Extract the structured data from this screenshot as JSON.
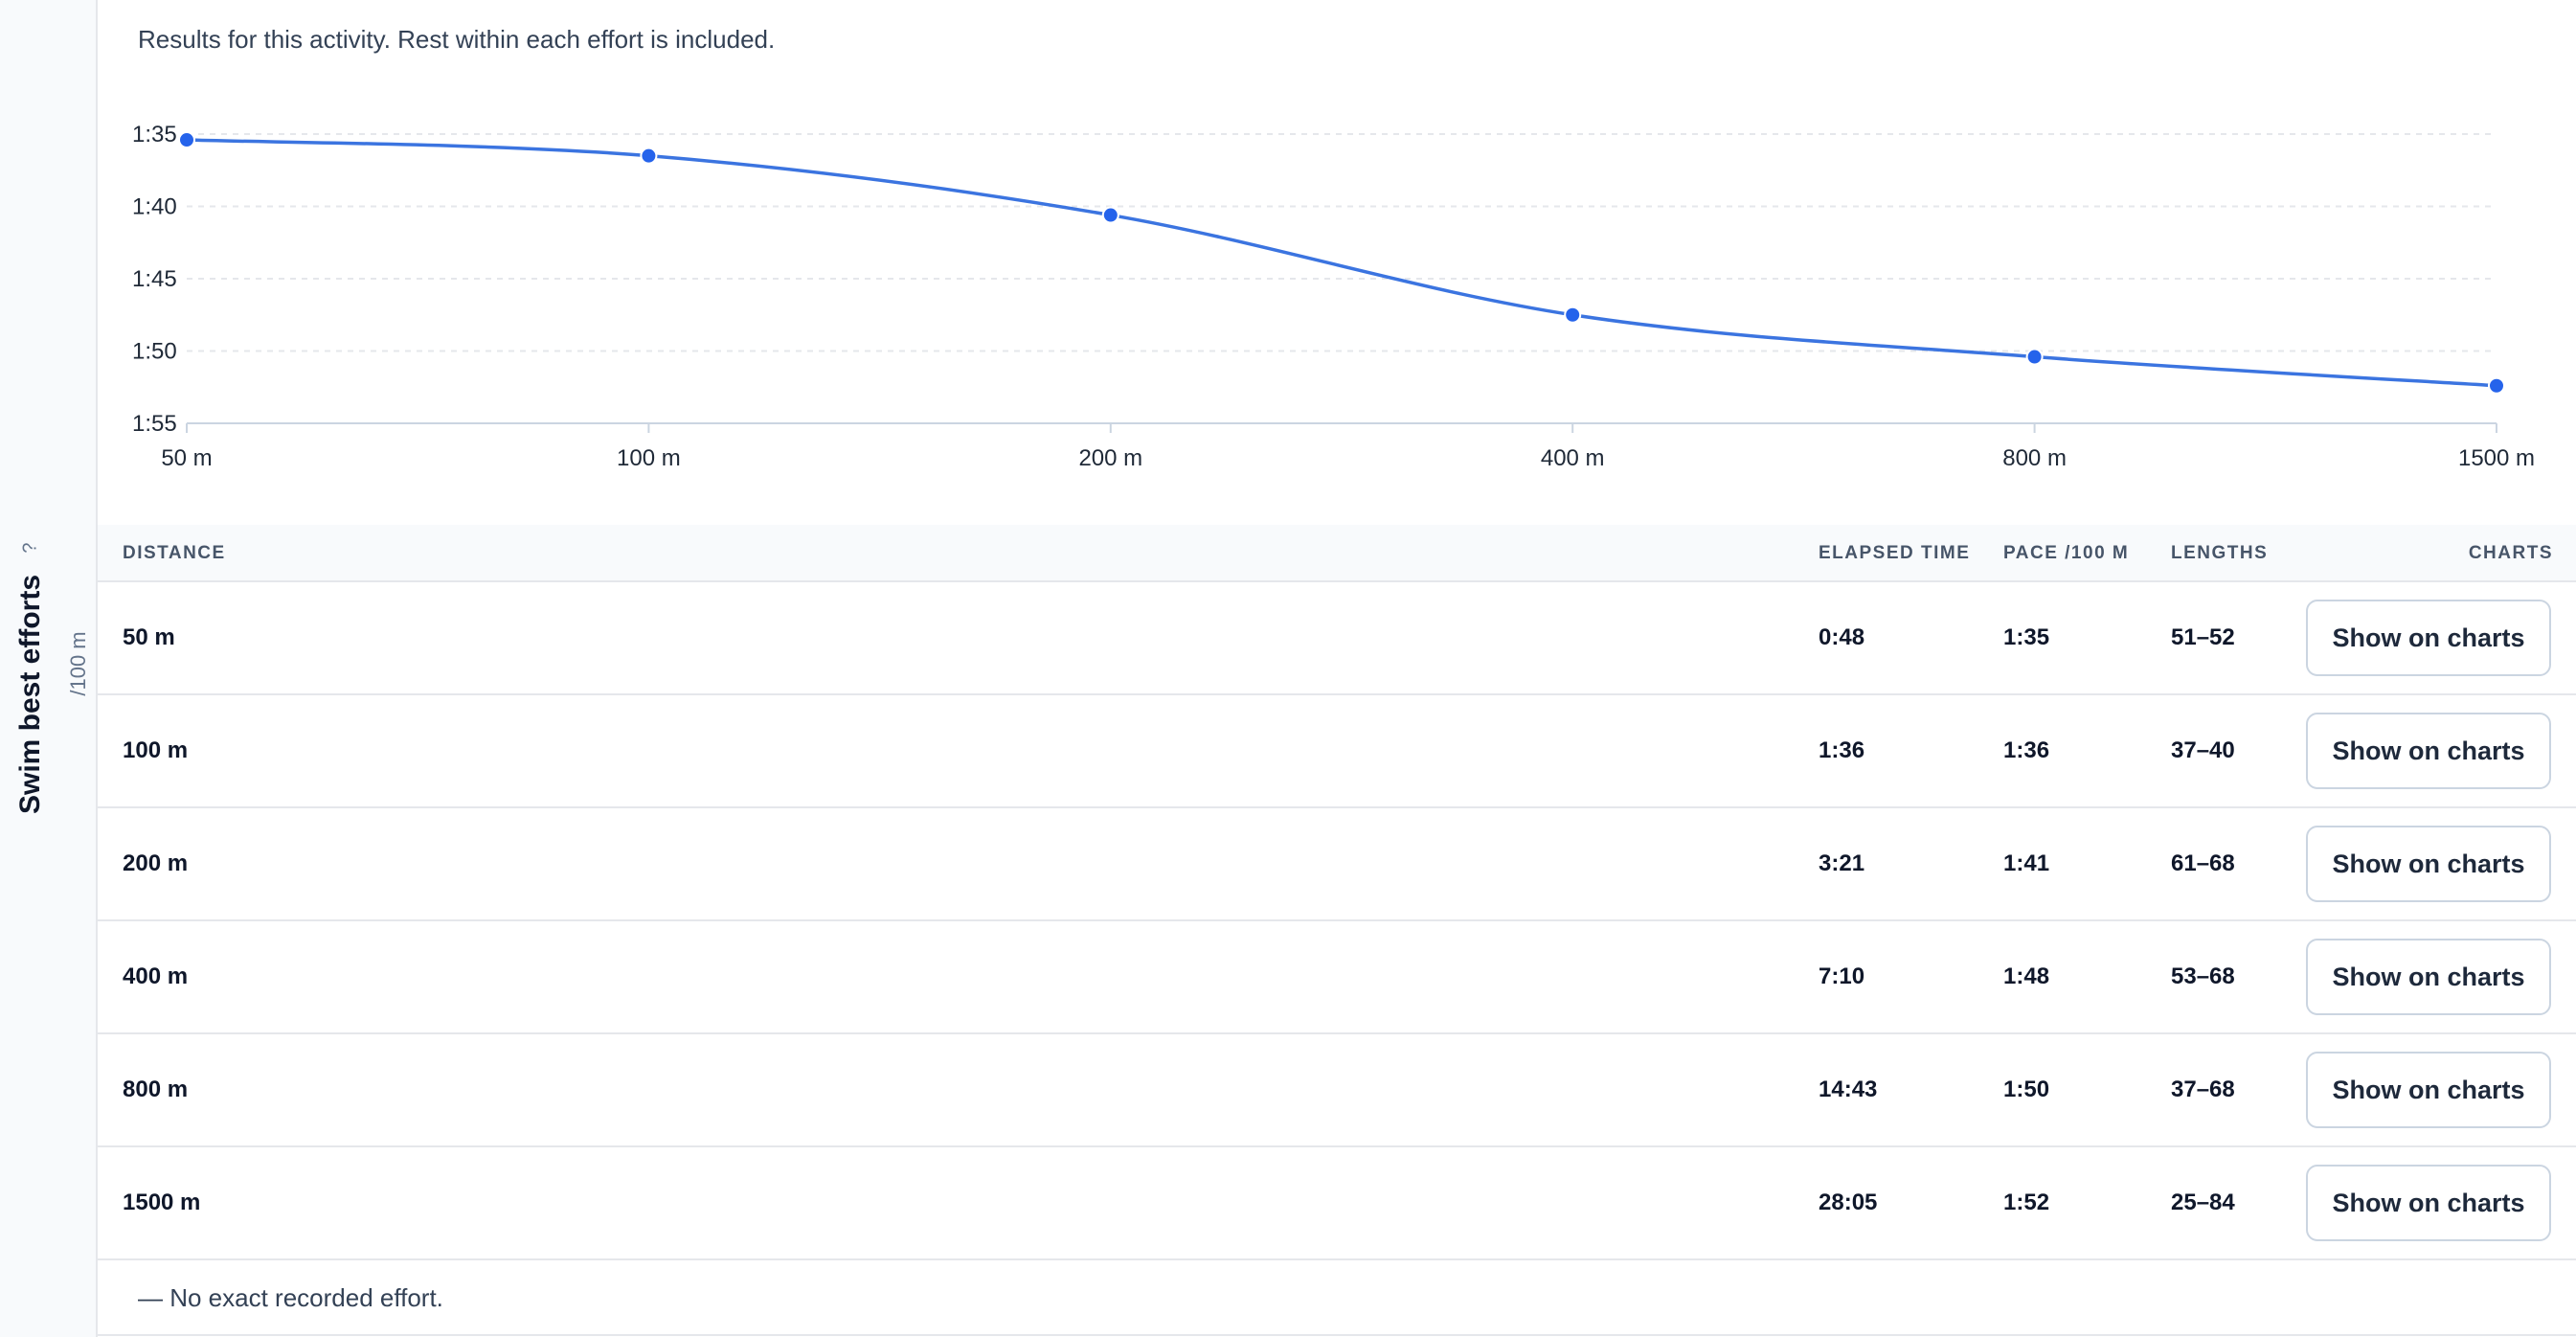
{
  "sidebar": {
    "title": "Swim best efforts",
    "help": "?",
    "unit": "/100 m"
  },
  "note": "Results for this activity. Rest within each effort is included.",
  "chart_data": {
    "type": "line",
    "title": "",
    "xlabel": "",
    "ylabel": "/100 m",
    "categories": [
      "50 m",
      "100 m",
      "200 m",
      "400 m",
      "800 m",
      "1500 m"
    ],
    "y_ticks": [
      "1:35",
      "1:40",
      "1:45",
      "1:50",
      "1:55"
    ],
    "y_tick_seconds": [
      95,
      100,
      105,
      110,
      115
    ],
    "ylim_seconds": [
      95,
      115
    ],
    "y_inverted": true,
    "grid": true,
    "color": "#3b74e0",
    "point_color": "#2563eb",
    "series": [
      {
        "values_seconds": [
          95.4,
          96.5,
          100.6,
          107.5,
          110.4,
          112.4
        ]
      }
    ]
  },
  "table": {
    "headers": {
      "distance": "DISTANCE",
      "elapsed": "ELAPSED TIME",
      "pace": "PACE /100 M",
      "lengths": "LENGTHS",
      "charts": "CHARTS"
    },
    "rows": [
      {
        "distance": "50 m",
        "elapsed": "0:48",
        "pace": "1:35",
        "lengths": "51–52",
        "action": "Show on charts"
      },
      {
        "distance": "100 m",
        "elapsed": "1:36",
        "pace": "1:36",
        "lengths": "37–40",
        "action": "Show on charts"
      },
      {
        "distance": "200 m",
        "elapsed": "3:21",
        "pace": "1:41",
        "lengths": "61–68",
        "action": "Show on charts"
      },
      {
        "distance": "400 m",
        "elapsed": "7:10",
        "pace": "1:48",
        "lengths": "53–68",
        "action": "Show on charts"
      },
      {
        "distance": "800 m",
        "elapsed": "14:43",
        "pace": "1:50",
        "lengths": "37–68",
        "action": "Show on charts"
      },
      {
        "distance": "1500 m",
        "elapsed": "28:05",
        "pace": "1:52",
        "lengths": "25–84",
        "action": "Show on charts"
      }
    ]
  },
  "footnote": "— No exact recorded effort."
}
